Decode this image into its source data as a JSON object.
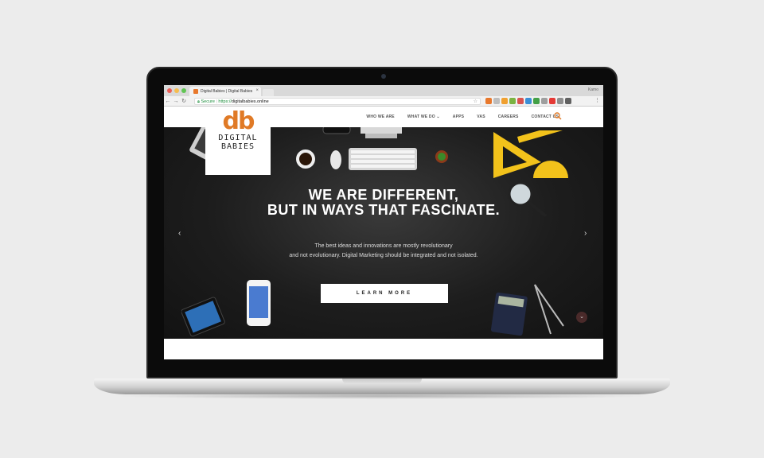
{
  "browser": {
    "tab_title": "Digital Babies | Digital Babies",
    "tab_close": "×",
    "profile": "Kamo",
    "secure_label": "Secure",
    "url_scheme": "https://",
    "url_host": "digitalbabies.online"
  },
  "logo": {
    "mark": "db",
    "line1": "DIGITAL",
    "line2": "BABIES",
    "accent_color": "#e07a26"
  },
  "nav": {
    "items": [
      {
        "label": "WHO WE ARE"
      },
      {
        "label": "WHAT WE DO ⌄"
      },
      {
        "label": "APPS"
      },
      {
        "label": "VAS"
      },
      {
        "label": "CAREERS"
      },
      {
        "label": "CONTACT US"
      }
    ],
    "search_icon": "search-icon"
  },
  "hero": {
    "headline_line1": "WE ARE DIFFERENT,",
    "headline_line2": "BUT IN WAYS THAT FASCINATE.",
    "sub_line1": "The best ideas and innovations are mostly revolutionary",
    "sub_line2": "and not evolutionary. Digital Marketing should be integrated and not isolated.",
    "cta": "LEARN MORE",
    "prev": "‹",
    "next": "›",
    "scroll": "⌄"
  }
}
